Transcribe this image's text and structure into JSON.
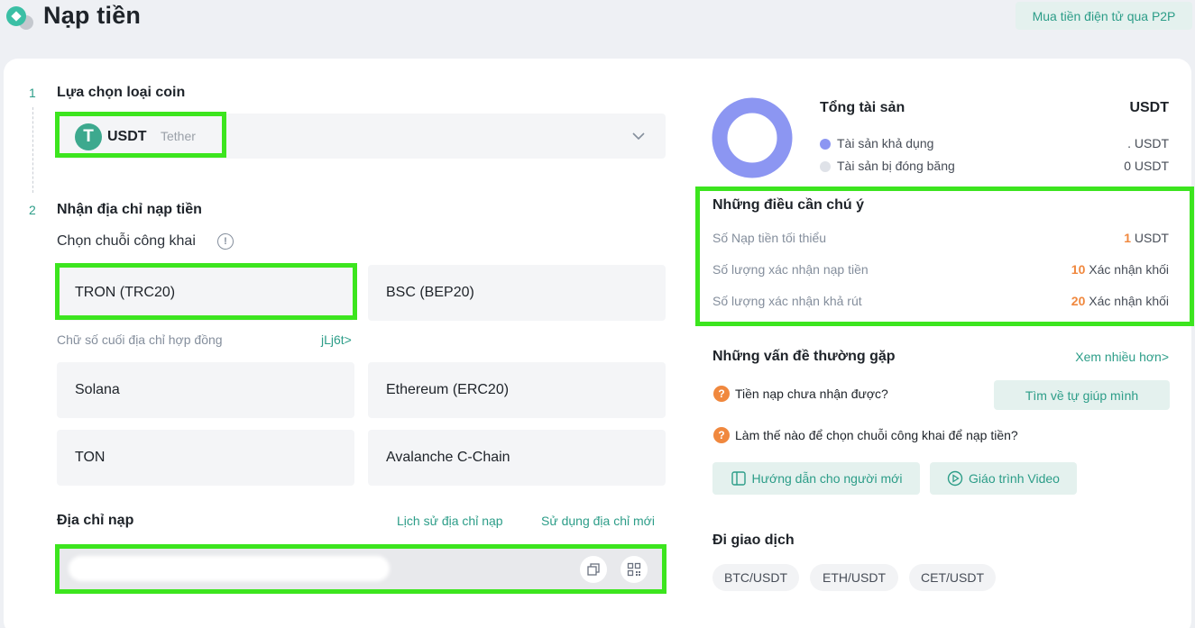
{
  "header": {
    "title": "Nạp tiền",
    "p2p_button": "Mua tiền điện tử qua P2P"
  },
  "step1": {
    "number": "1",
    "title": "Lựa chọn loại coin",
    "coin": {
      "symbol": "USDT",
      "name": "Tether",
      "icon_letter": "T"
    }
  },
  "step2": {
    "number": "2",
    "title": "Nhận địa chỉ nạp tiền",
    "chain_label": "Chọn chuỗi công khai",
    "chains": [
      "TRON (TRC20)",
      "BSC (BEP20)",
      "Solana",
      "Ethereum (ERC20)",
      "TON",
      "Avalanche C-Chain"
    ],
    "selected_chain": "TRON (TRC20)",
    "contract_label": "Chữ số cuối địa chỉ hợp đồng",
    "contract_value": "jLj6t>",
    "address_label": "Địa chỉ nạp",
    "address_history": "Lịch sử địa chỉ nạp",
    "address_new": "Sử dụng địa chỉ mới"
  },
  "assets": {
    "title": "Tổng tài sản",
    "unit": "USDT",
    "available_label": "Tài sản khả dụng",
    "available_value": ". USDT",
    "frozen_label": "Tài sản bị đóng băng",
    "frozen_value": "0 USDT",
    "colors": {
      "available": "#8c96f2",
      "frozen": "#dfe2e8"
    }
  },
  "notes": {
    "title": "Những điều cần chú ý",
    "rows": [
      {
        "label": "Số Nạp tiền tối thiểu",
        "number": "1",
        "suffix": "USDT"
      },
      {
        "label": "Số lượng xác nhận nạp tiền",
        "number": "10",
        "suffix": "Xác nhận khối"
      },
      {
        "label": "Số lượng xác nhận khả rút",
        "number": "20",
        "suffix": "Xác nhận khối"
      }
    ]
  },
  "faq": {
    "title": "Những vấn đề thường gặp",
    "more": "Xem nhiều hơn>",
    "q1": "Tiền nạp chưa nhận được?",
    "help_button": "Tìm về tự giúp mình",
    "q2": "Làm thế nào để chọn chuỗi công khai để nạp tiền?",
    "guide_button": "Hướng dẫn cho người mới",
    "video_button": "Giáo trình Video"
  },
  "trade": {
    "title": "Đi giao dịch",
    "pairs": [
      "BTC/USDT",
      "ETH/USDT",
      "CET/USDT"
    ]
  },
  "accent_color": "#2c9d88",
  "highlight_color": "#3ce51e"
}
